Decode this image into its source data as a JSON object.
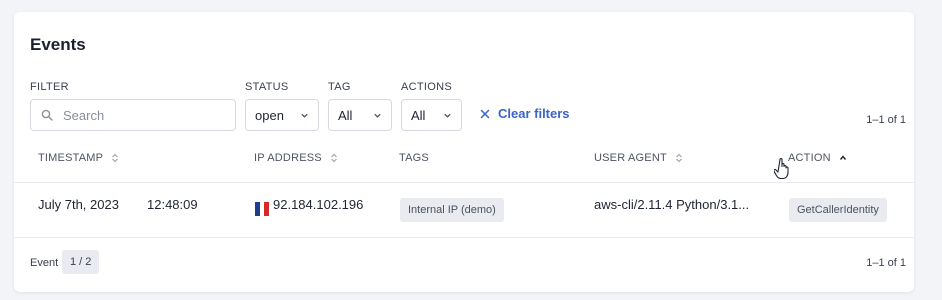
{
  "panel": {
    "title": "Events"
  },
  "filters": {
    "filter_label": "FILTER",
    "search_placeholder": "Search",
    "status_label": "STATUS",
    "status_value": "open",
    "tag_label": "TAG",
    "tag_value": "All",
    "actions_label": "ACTIONS",
    "actions_value": "All",
    "clear_label": "Clear filters"
  },
  "result_count_top": "1–1 of 1",
  "columns": {
    "timestamp": "TIMESTAMP",
    "ip_address": "IP ADDRESS",
    "tags": "TAGS",
    "user_agent": "USER AGENT",
    "action": "ACTION"
  },
  "rows": [
    {
      "date": "July 7th, 2023",
      "time": "12:48:09",
      "flag_colors": [
        "#1f3c8f",
        "#ffffff",
        "#d62a2a"
      ],
      "ip": "92.184.102.196",
      "tag": "Internal IP (demo)",
      "user_agent": "aws-cli/2.11.4 Python/3.1...",
      "action": "GetCallerIdentity"
    }
  ],
  "footer": {
    "event_label": "Event",
    "page": "1 / 2",
    "result_count": "1–1 of 1"
  },
  "colors": {
    "accent": "#3b63c9",
    "chip_bg": "#e9ebf0"
  }
}
